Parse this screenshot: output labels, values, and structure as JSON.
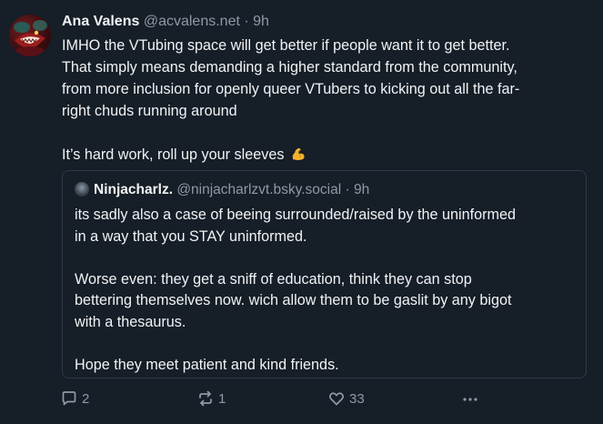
{
  "post": {
    "author_name": "Ana Valens",
    "author_handle": "@acvalens.net",
    "separator": "·",
    "time": "9h",
    "text_lines": [
      "IMHO the VTubing space will get better if people want it to get better.",
      "That simply means demanding a higher standard from the community,",
      "from more inclusion for openly queer VTubers to kicking out all the far-",
      "right chuds running around"
    ],
    "text_second": "It’s hard work, roll up your sleeves",
    "emoji": "flexed-biceps-emoji"
  },
  "quote": {
    "author_name": "Ninjacharlz.",
    "author_handle": "@ninjacharlzvt.bsky.social",
    "separator": "·",
    "time": "9h",
    "paragraph1_lines": [
      "its sadly also a case of beeing surrounded/raised by the uninformed",
      "in a way that you STAY uninformed."
    ],
    "paragraph2_lines": [
      "Worse even: they get a sniff of education, think they can stop",
      "bettering themselves now. wich allow them to be gaslit by any bigot",
      "with a thesaurus."
    ],
    "paragraph3": "Hope they meet patient and kind friends."
  },
  "actions": {
    "reply_count": "2",
    "repost_count": "1",
    "like_count": "33",
    "reply_icon": "speech-bubble-icon",
    "repost_icon": "repost-arrows-icon",
    "like_icon": "heart-icon",
    "more_icon": "ellipsis-icon"
  },
  "colors": {
    "background": "#161e27",
    "text_primary": "#f1f3f5",
    "text_secondary": "#8d9aa8",
    "border": "#2e3a48"
  }
}
